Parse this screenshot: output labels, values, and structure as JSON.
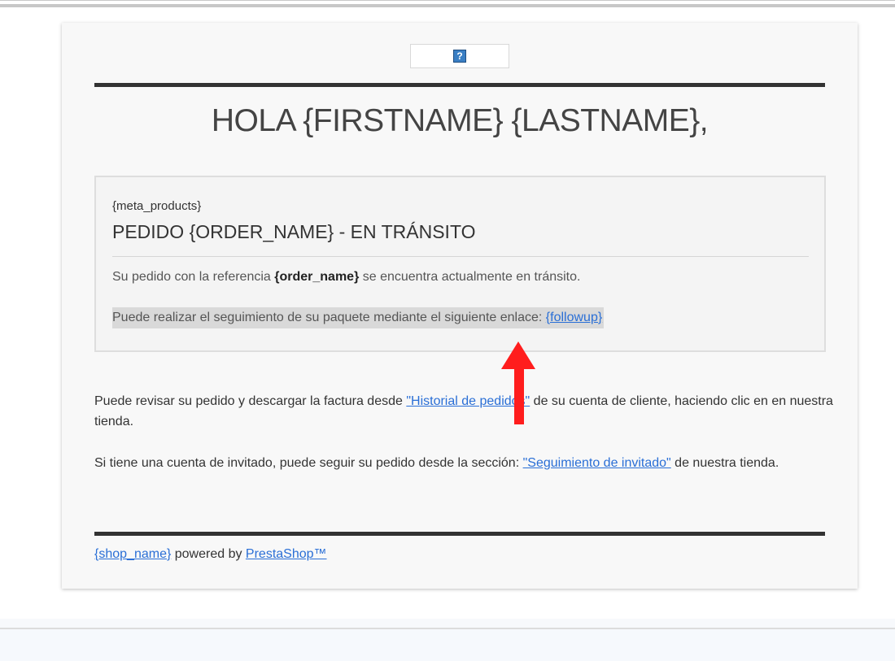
{
  "email": {
    "logo": {
      "icon": "question-mark-icon",
      "glyph": "?"
    },
    "greeting": "HOLA {FIRSTNAME} {LASTNAME},",
    "order_box": {
      "meta": "{meta_products}",
      "title": "PEDIDO {ORDER_NAME} - EN TRÁNSITO",
      "ref_before": "Su pedido con la referencia ",
      "ref_bold": "{order_name}",
      "ref_after": " se encuentra actualmente en tránsito.",
      "track_text": "Puede realizar el seguimiento de su paquete mediante el siguiente enlace: ",
      "track_link": "{followup}"
    },
    "para1": {
      "before": "Puede revisar su pedido y descargar la factura desde ",
      "link": "\"Historial de pedidos\"",
      "after": " de su cuenta de cliente, haciendo clic en en nuestra tienda."
    },
    "para2": {
      "before": "Si tiene una cuenta de invitado, puede seguir su pedido desde la sección: ",
      "link": "\"Seguimiento de invitado\"",
      "after": " de nuestra tienda."
    },
    "footer": {
      "shop_link": "{shop_name}",
      "powered": " powered by ",
      "presta_link": "PrestaShop™"
    }
  },
  "colors": {
    "link": "#2a6fd6",
    "rule": "#333333",
    "highlight": "#d9d9d9",
    "annotation_arrow": "#ff1d1d"
  },
  "annotation": {
    "icon": "red-arrow-up-icon"
  }
}
